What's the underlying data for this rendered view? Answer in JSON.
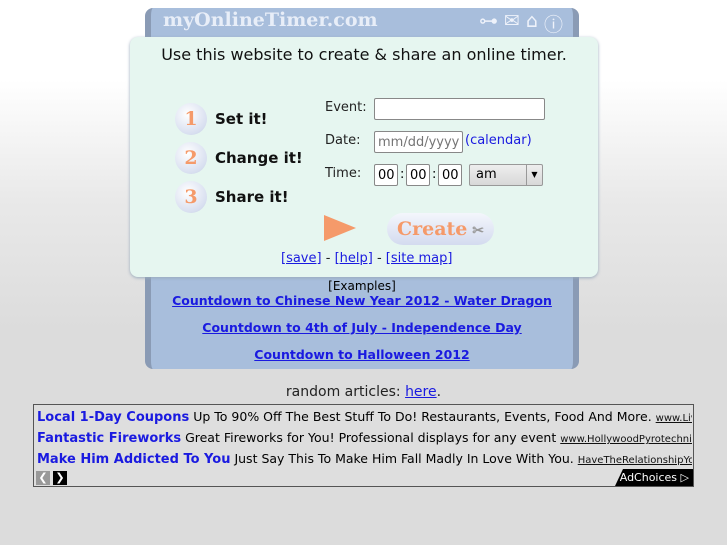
{
  "header": {
    "logo": "myOnlineTimer.com",
    "icons": [
      "key-icon",
      "mail-icon",
      "home-icon",
      "help-icon"
    ]
  },
  "intro": "Use this website to create & share an online timer.",
  "steps": [
    {
      "num": "1",
      "label": "Set it!"
    },
    {
      "num": "2",
      "label": "Change it!"
    },
    {
      "num": "3",
      "label": "Share it!"
    }
  ],
  "form": {
    "event_label": "Event:",
    "event_value": "",
    "date_label": "Date:",
    "date_placeholder": "mm/dd/yyyy",
    "calendar_link": "(calendar)",
    "time_label": "Time:",
    "hour": "00",
    "minute": "00",
    "second": "00",
    "ampm": "am",
    "create_label": "Create"
  },
  "links": {
    "save": "[save]",
    "help": "[help]",
    "sitemap": "[site map]",
    "sep": "-"
  },
  "examples": {
    "title": "[Examples]",
    "items": [
      "Countdown to Chinese New Year 2012 - Water Dragon",
      "Countdown to 4th of July - Independence Day",
      "Countdown to Halloween 2012"
    ]
  },
  "random": {
    "label": "random articles:",
    "link": "here"
  },
  "ads": [
    {
      "title": "Local 1-Day Coupons",
      "text": "Up To 90% Off The Best Stuff To Do! Restaurants, Events, Food And More.",
      "url": "www.LivingSocial.c"
    },
    {
      "title": "Fantastic Fireworks",
      "text": "Great Fireworks for You! Professional displays for any event",
      "url": "www.HollywoodPyrotechnics.com"
    },
    {
      "title": "Make Him Addicted To You",
      "text": "Just Say This To Make Him Fall Madly In Love With You.",
      "url": "HaveTheRelationshipYouWant.com"
    }
  ],
  "adchoices": "AdChoices ▷"
}
